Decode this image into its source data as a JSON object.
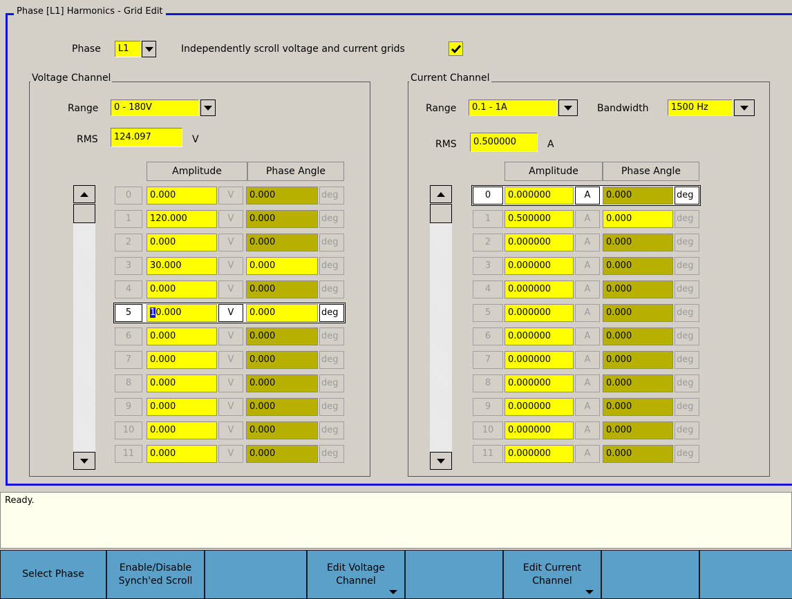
{
  "frame": {
    "title": "Phase [L1] Harmonics - Grid Edit"
  },
  "phase": {
    "label": "Phase",
    "value": "L1"
  },
  "sync_scroll": {
    "label": "Independently scroll voltage and current grids",
    "checked": true
  },
  "voltage": {
    "group_title": "Voltage Channel",
    "range_label": "Range",
    "range_value": "0 - 180V",
    "rms_label": "RMS",
    "rms_value": "124.097",
    "rms_unit": "V",
    "col_amplitude": "Amplitude",
    "col_phase": "Phase Angle",
    "rows": [
      {
        "idx": "0",
        "amp": "0.000",
        "unit": "V",
        "phase": "0.000",
        "punit": "deg",
        "phase_yellow": false
      },
      {
        "idx": "1",
        "amp": "120.000",
        "unit": "V",
        "phase": "0.000",
        "punit": "deg",
        "phase_yellow": false
      },
      {
        "idx": "2",
        "amp": "0.000",
        "unit": "V",
        "phase": "0.000",
        "punit": "deg",
        "phase_yellow": false
      },
      {
        "idx": "3",
        "amp": "30.000",
        "unit": "V",
        "phase": "0.000",
        "punit": "deg",
        "phase_yellow": true
      },
      {
        "idx": "4",
        "amp": "0.000",
        "unit": "V",
        "phase": "0.000",
        "punit": "deg",
        "phase_yellow": false
      },
      {
        "idx": "5",
        "amp_cursor": "1",
        "amp": "0.000",
        "unit": "V",
        "phase": "0.000",
        "punit": "deg",
        "phase_yellow": true
      },
      {
        "idx": "6",
        "amp": "0.000",
        "unit": "V",
        "phase": "0.000",
        "punit": "deg",
        "phase_yellow": false
      },
      {
        "idx": "7",
        "amp": "0.000",
        "unit": "V",
        "phase": "0.000",
        "punit": "deg",
        "phase_yellow": false
      },
      {
        "idx": "8",
        "amp": "0.000",
        "unit": "V",
        "phase": "0.000",
        "punit": "deg",
        "phase_yellow": false
      },
      {
        "idx": "9",
        "amp": "0.000",
        "unit": "V",
        "phase": "0.000",
        "punit": "deg",
        "phase_yellow": false
      },
      {
        "idx": "10",
        "amp": "0.000",
        "unit": "V",
        "phase": "0.000",
        "punit": "deg",
        "phase_yellow": false
      },
      {
        "idx": "11",
        "amp": "0.000",
        "unit": "V",
        "phase": "0.000",
        "punit": "deg",
        "phase_yellow": false
      }
    ],
    "active_row": 5
  },
  "current": {
    "group_title": "Current Channel",
    "range_label": "Range",
    "range_value": "0.1 - 1A",
    "bandwidth_label": "Bandwidth",
    "bandwidth_value": "1500 Hz",
    "rms_label": "RMS",
    "rms_value": "0.500000",
    "rms_unit": "A",
    "col_amplitude": "Amplitude",
    "col_phase": "Phase Angle",
    "rows": [
      {
        "idx": "0",
        "amp": "0.000000",
        "unit": "A",
        "phase": "0.000",
        "punit": "deg",
        "phase_yellow": false
      },
      {
        "idx": "1",
        "amp": "0.500000",
        "unit": "A",
        "phase": "0.000",
        "punit": "deg",
        "phase_yellow": true
      },
      {
        "idx": "2",
        "amp": "0.000000",
        "unit": "A",
        "phase": "0.000",
        "punit": "deg",
        "phase_yellow": false
      },
      {
        "idx": "3",
        "amp": "0.000000",
        "unit": "A",
        "phase": "0.000",
        "punit": "deg",
        "phase_yellow": false
      },
      {
        "idx": "4",
        "amp": "0.000000",
        "unit": "A",
        "phase": "0.000",
        "punit": "deg",
        "phase_yellow": false
      },
      {
        "idx": "5",
        "amp": "0.000000",
        "unit": "A",
        "phase": "0.000",
        "punit": "deg",
        "phase_yellow": false
      },
      {
        "idx": "6",
        "amp": "0.000000",
        "unit": "A",
        "phase": "0.000",
        "punit": "deg",
        "phase_yellow": false
      },
      {
        "idx": "7",
        "amp": "0.000000",
        "unit": "A",
        "phase": "0.000",
        "punit": "deg",
        "phase_yellow": false
      },
      {
        "idx": "8",
        "amp": "0.000000",
        "unit": "A",
        "phase": "0.000",
        "punit": "deg",
        "phase_yellow": false
      },
      {
        "idx": "9",
        "amp": "0.000000",
        "unit": "A",
        "phase": "0.000",
        "punit": "deg",
        "phase_yellow": false
      },
      {
        "idx": "10",
        "amp": "0.000000",
        "unit": "A",
        "phase": "0.000",
        "punit": "deg",
        "phase_yellow": false
      },
      {
        "idx": "11",
        "amp": "0.000000",
        "unit": "A",
        "phase": "0.000",
        "punit": "deg",
        "phase_yellow": false
      }
    ],
    "active_row": 0
  },
  "status": {
    "text": "Ready."
  },
  "softkeys": [
    {
      "label": "Select Phase",
      "has_menu": false
    },
    {
      "label": "Enable/Disable\nSynch'ed Scroll",
      "has_menu": false
    },
    {
      "label": "",
      "has_menu": false
    },
    {
      "label": "Edit Voltage\nChannel",
      "has_menu": true
    },
    {
      "label": "",
      "has_menu": false
    },
    {
      "label": "Edit Current\nChannel",
      "has_menu": true
    },
    {
      "label": "",
      "has_menu": false
    },
    {
      "label": "",
      "has_menu": false
    }
  ],
  "colors": {
    "frame_border": "#1414d8",
    "field_yellow": "#ffff00",
    "field_olive": "#b8b000",
    "softkey_blue": "#5aa0c8",
    "status_bg": "#ffffee"
  }
}
